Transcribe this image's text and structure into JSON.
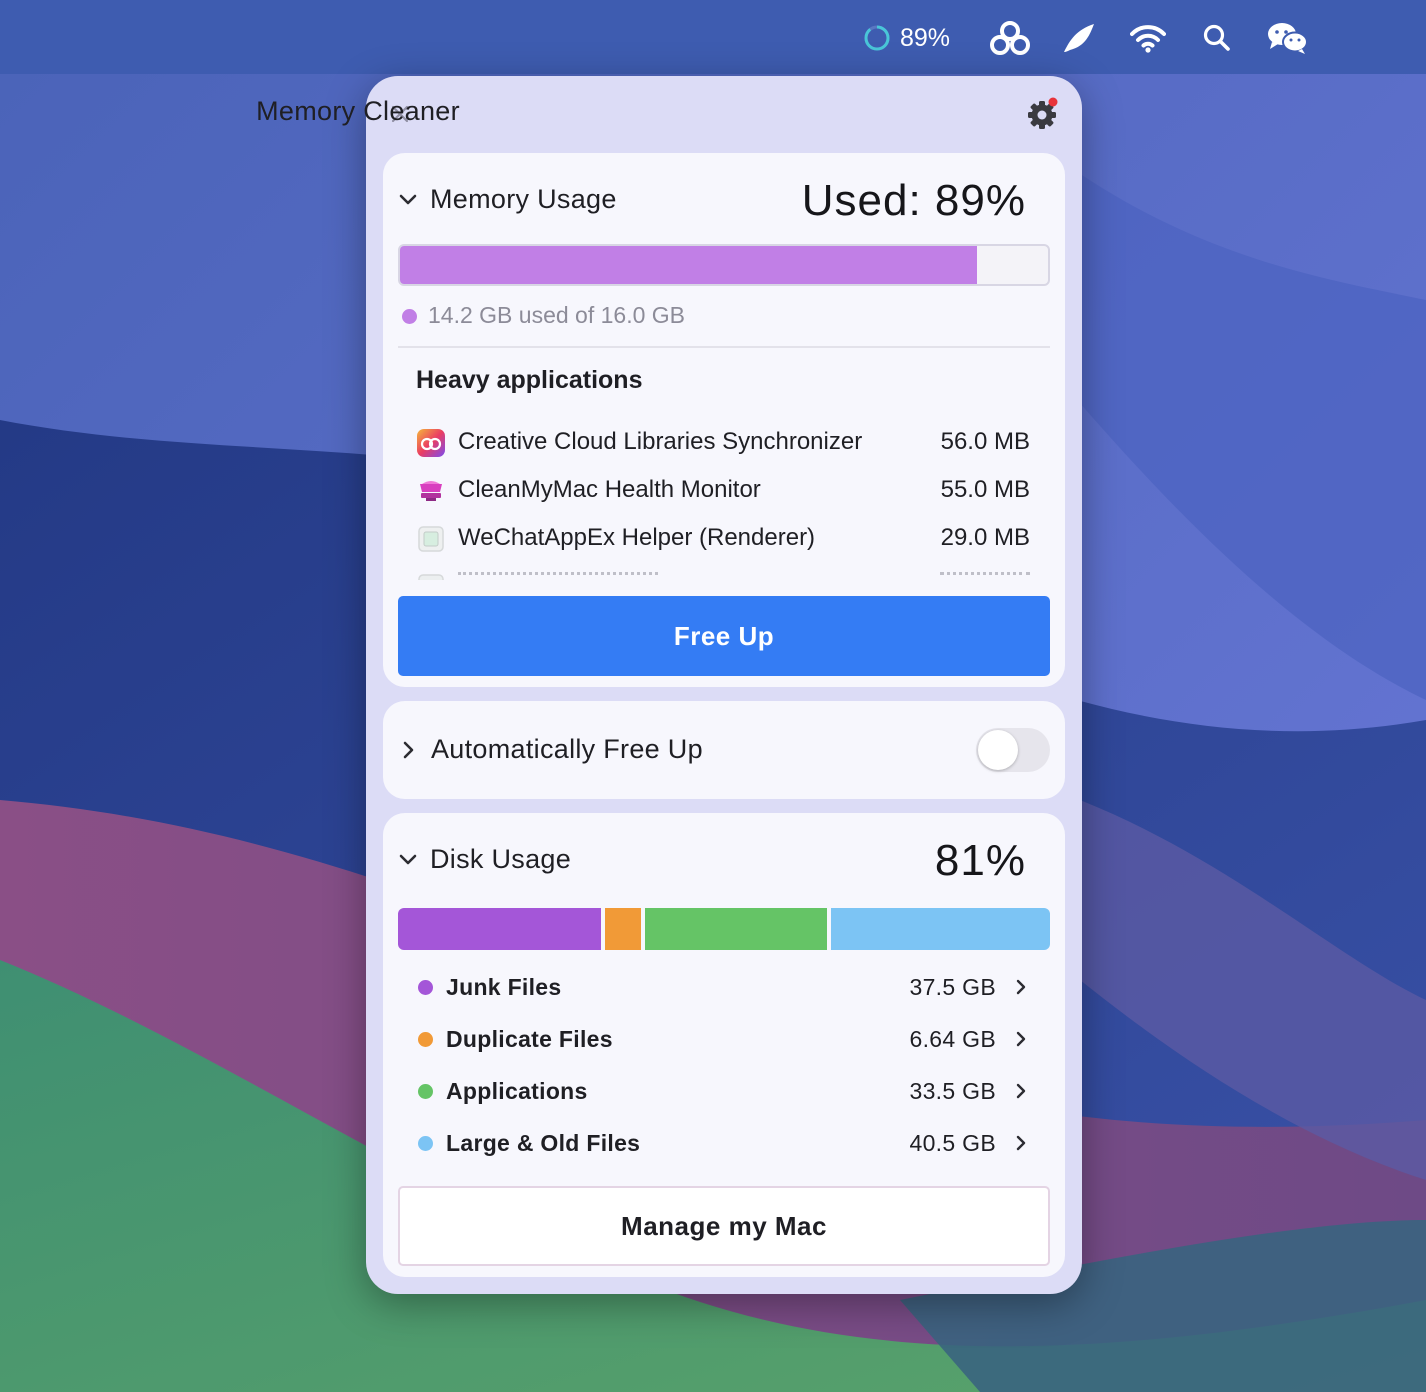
{
  "menubar": {
    "memory_percent": "89%",
    "colors": {
      "background": "#3e5cb0"
    },
    "icons": [
      "progress-ring-icon",
      "clover-icon",
      "feather-icon",
      "wifi-icon",
      "search-icon",
      "wechat-icon"
    ]
  },
  "panel": {
    "title": "Memory Cleaner",
    "icons": {
      "close": "close-icon",
      "settings": "gear-icon",
      "settings_badge_color": "#e8333a"
    }
  },
  "memory": {
    "section_title": "Memory Usage",
    "used_label": "Used: 89%",
    "used_fraction": 0.89,
    "summary": "14.2 GB used of 16.0 GB",
    "bar_color": "#c17fe6",
    "heavy_title": "Heavy applications",
    "apps": [
      {
        "name": "Creative Cloud Libraries Synchronizer",
        "size": "56.0 MB",
        "icon": "creative-cloud-icon"
      },
      {
        "name": "CleanMyMac Health Monitor",
        "size": "55.0 MB",
        "icon": "cleanmymac-icon"
      },
      {
        "name": "WeChatAppEx Helper (Renderer)",
        "size": "29.0 MB",
        "icon": "wechat-helper-icon"
      }
    ],
    "free_up_label": "Free Up",
    "button_color": "#347cf4"
  },
  "auto_free": {
    "label": "Automatically Free Up",
    "enabled": false
  },
  "disk": {
    "section_title": "Disk Usage",
    "percent": "81%",
    "items": [
      {
        "label": "Junk Files",
        "size": "37.5 GB",
        "gb": 37.5,
        "color": "#a456d8"
      },
      {
        "label": "Duplicate Files",
        "size": "6.64 GB",
        "gb": 6.64,
        "color": "#f19a37"
      },
      {
        "label": "Applications",
        "size": "33.5 GB",
        "gb": 33.5,
        "color": "#65c466"
      },
      {
        "label": "Large & Old Files",
        "size": "40.5 GB",
        "gb": 40.5,
        "color": "#7cc4f4"
      }
    ],
    "manage_label": "Manage my Mac"
  }
}
